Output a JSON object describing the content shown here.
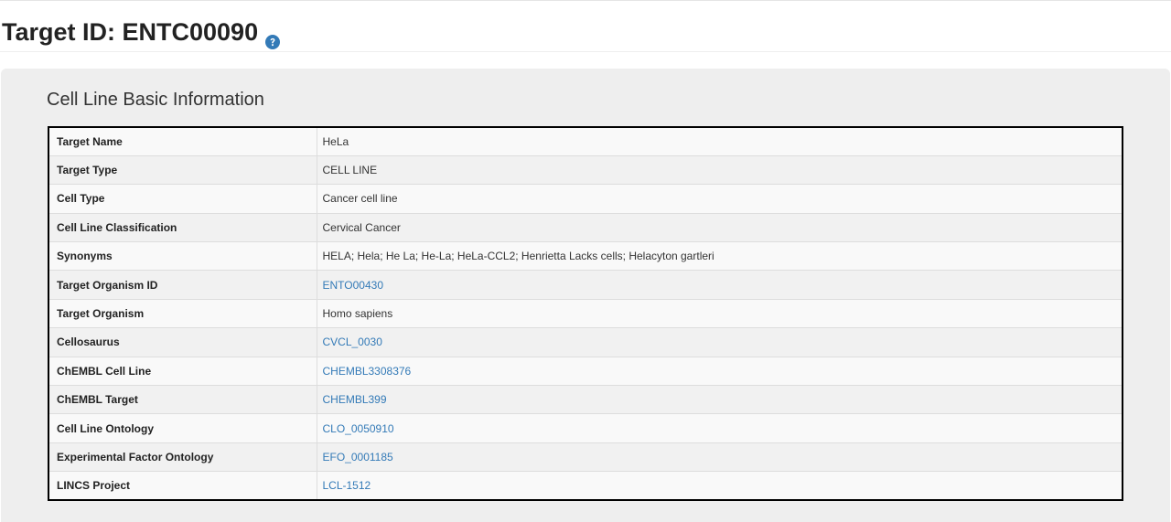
{
  "header": {
    "title": "Target ID: ENTC00090",
    "help_icon": "question-circle-icon",
    "help_icon_color": "#337ab7"
  },
  "section": {
    "title": "Cell Line Basic Information"
  },
  "colors": {
    "link": "#337ab7",
    "panel_background": "#eeeeee",
    "table_border": "#000000"
  },
  "table": {
    "rows": [
      {
        "label": "Target Name",
        "value": "HeLa",
        "is_link": false
      },
      {
        "label": "Target Type",
        "value": "CELL LINE",
        "is_link": false
      },
      {
        "label": "Cell Type",
        "value": "Cancer cell line",
        "is_link": false
      },
      {
        "label": "Cell Line Classification",
        "value": "Cervical Cancer",
        "is_link": false
      },
      {
        "label": "Synonyms",
        "value": "HELA; Hela; He La; He-La; HeLa-CCL2; Henrietta Lacks cells; Helacyton gartleri",
        "is_link": false
      },
      {
        "label": "Target Organism ID",
        "value": "ENTO00430",
        "is_link": true
      },
      {
        "label": "Target Organism",
        "value": "Homo sapiens",
        "is_link": false
      },
      {
        "label": "Cellosaurus",
        "value": "CVCL_0030",
        "is_link": true
      },
      {
        "label": "ChEMBL Cell Line",
        "value": "CHEMBL3308376",
        "is_link": true
      },
      {
        "label": "ChEMBL Target",
        "value": "CHEMBL399",
        "is_link": true
      },
      {
        "label": "Cell Line Ontology",
        "value": "CLO_0050910",
        "is_link": true
      },
      {
        "label": "Experimental Factor Ontology",
        "value": "EFO_0001185",
        "is_link": true
      },
      {
        "label": "LINCS Project",
        "value": "LCL-1512",
        "is_link": true
      }
    ]
  }
}
